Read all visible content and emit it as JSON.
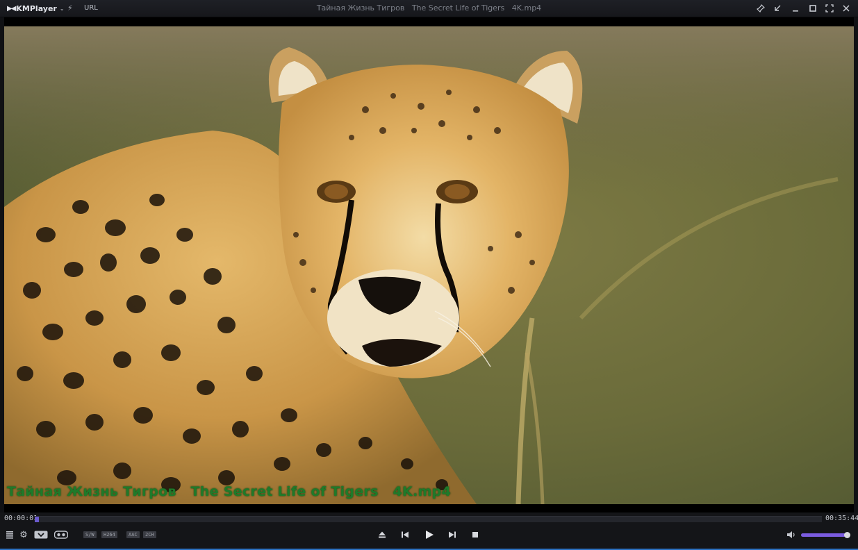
{
  "app": {
    "name": "KMPlayer",
    "url_label": "URL"
  },
  "window": {
    "title": "Тайная Жизнь Тигров   The Secret Life of Tigers   4K.mp4"
  },
  "icons": {
    "logo": "kmplayer-logo-icon",
    "dropdown": "chevron-down-icon",
    "speed": "lightning-icon",
    "pin": "pin-icon",
    "mini": "compact-mode-icon",
    "minimize": "minimize-icon",
    "maximize": "maximize-icon",
    "fullscreen": "fullscreen-icon",
    "close": "close-icon",
    "playlist": "playlist-icon",
    "settings": "gear-icon",
    "threed": "3d-icon",
    "vr": "vr-icon",
    "eject": "eject-icon",
    "prev": "previous-icon",
    "play": "play-icon",
    "next": "next-icon",
    "stop": "stop-icon",
    "volume": "speaker-icon"
  },
  "video": {
    "subject": "cheetah close-up in grassland",
    "osd_text": "Тайная Жизнь Тигров   The Secret Life of Tigers   4K.mp4"
  },
  "playback": {
    "current_time": "00:00:01",
    "total_time": "00:35:44",
    "progress": 0.005
  },
  "badges": [
    "S/W",
    "H264",
    "AAC",
    "2CH"
  ],
  "volume": {
    "level": 0.97
  },
  "colors": {
    "accent": "#7b5ce0",
    "osd": "#1f7a2a",
    "seek_fill": "#6a5acd"
  }
}
